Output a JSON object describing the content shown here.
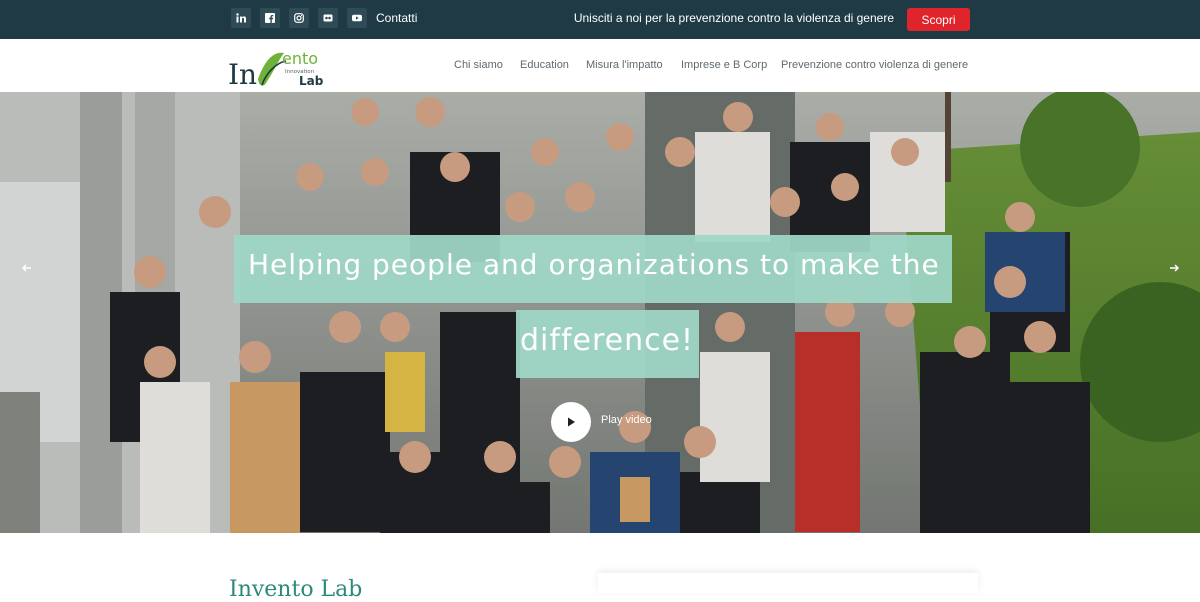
{
  "topbar": {
    "social": [
      {
        "icon": "linkedin-icon",
        "glyph": "in"
      },
      {
        "icon": "facebook-icon",
        "glyph": "f"
      },
      {
        "icon": "instagram-icon",
        "glyph": "ig"
      },
      {
        "icon": "flickr-icon",
        "glyph": "••"
      },
      {
        "icon": "youtube-icon",
        "glyph": "yt"
      }
    ],
    "contact_label": "Contatti",
    "promo_text": "Unisciti a noi per la prevenzione contro la violenza di genere",
    "cta_label": "Scopri",
    "background": "#1f3a44",
    "cta_color": "#e0242c"
  },
  "header": {
    "logo_text_main": "Invento",
    "logo_sub": "Innovation",
    "logo_lab": "Lab",
    "nav": [
      "Chi siamo",
      "Education",
      "Misura l'impatto",
      "Imprese e B Corp",
      "Prevenzione contro violenza di genere"
    ]
  },
  "hero": {
    "headline_line1": "Helping people and organizations to make the",
    "headline_line2": "difference!",
    "play_label": "Play video",
    "accent": "#9fd7c7"
  },
  "below": {
    "heading_partial": "Invento Lab"
  }
}
